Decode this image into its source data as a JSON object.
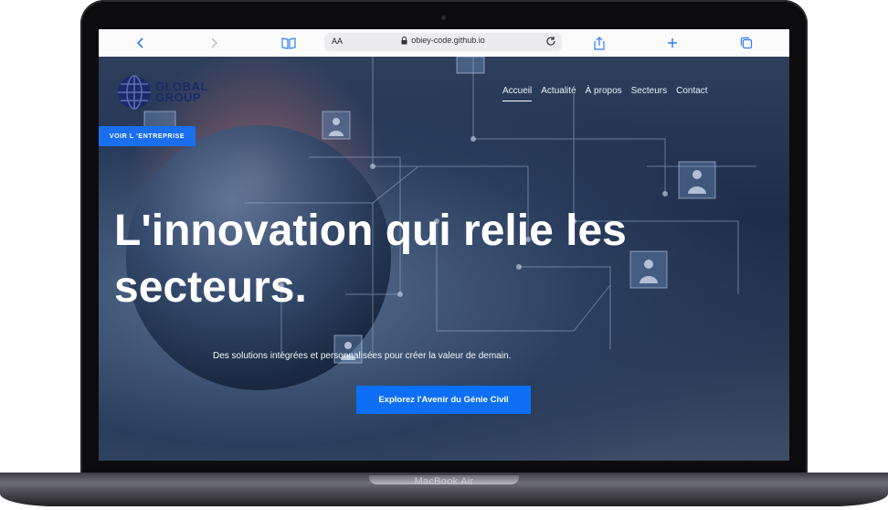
{
  "device": {
    "label": "MacBook Air"
  },
  "browser": {
    "aa": "AA",
    "url": "obiey-code.github.io",
    "icons": [
      "back-icon",
      "forward-icon",
      "bookmarks-icon",
      "lock-icon",
      "reload-icon",
      "share-icon",
      "new-tab-icon",
      "tabs-icon"
    ]
  },
  "site": {
    "logo": {
      "line1": "GLOBAL",
      "line2": "GROUP"
    },
    "nav": [
      {
        "label": "Accueil",
        "active": true
      },
      {
        "label": "Actualité",
        "active": false
      },
      {
        "label": "À propos",
        "active": false
      },
      {
        "label": "Secteurs",
        "active": false
      },
      {
        "label": "Contact",
        "active": false
      }
    ],
    "voir_button": "VOIR L 'ENTREPRISE",
    "headline_line1": "L'innovation qui relie les",
    "headline_line2": "secteurs.",
    "tagline": "Des solutions intégrées et personnalisées pour créer la valeur de demain.",
    "cta": "Explorez l'Avenir du Génie Civil"
  },
  "colors": {
    "accent": "#0d6ff5",
    "logo": "#1a2a6b"
  }
}
